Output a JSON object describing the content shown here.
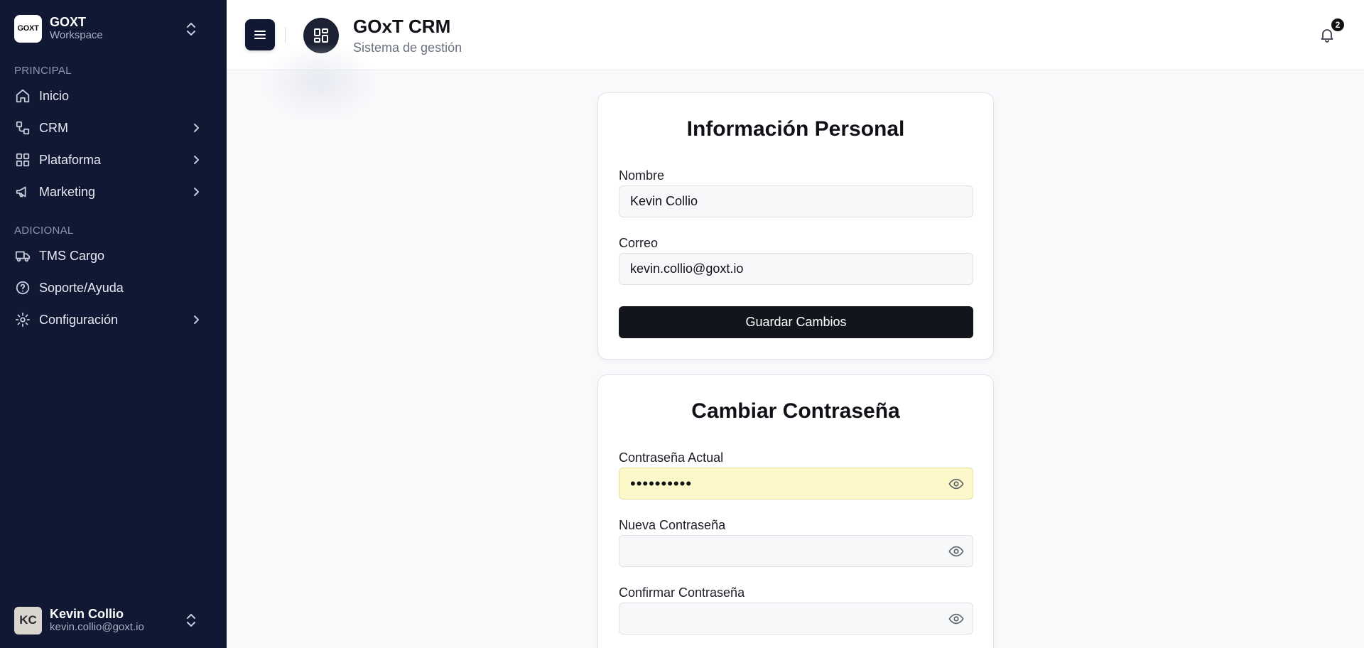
{
  "workspace": {
    "logo_text": "GOXT",
    "name": "GOXT",
    "subtitle": "Workspace",
    "toggle_icon": "chevrons-up-down-icon"
  },
  "sidebar": {
    "sections": [
      {
        "label": "PRINCIPAL"
      },
      {
        "label": "ADICIONAL"
      }
    ],
    "items": [
      {
        "label": "Inicio",
        "icon": "home-icon",
        "has_chevron": false
      },
      {
        "label": "CRM",
        "icon": "workflow-icon",
        "has_chevron": true
      },
      {
        "label": "Plataforma",
        "icon": "grid-icon",
        "has_chevron": true
      },
      {
        "label": "Marketing",
        "icon": "megaphone-icon",
        "has_chevron": true
      },
      {
        "label": "TMS Cargo",
        "icon": "truck-icon",
        "has_chevron": false
      },
      {
        "label": "Soporte/Ayuda",
        "icon": "help-circle-icon",
        "has_chevron": false
      },
      {
        "label": "Configuración",
        "icon": "gear-icon",
        "has_chevron": true
      }
    ]
  },
  "user": {
    "initials": "KC",
    "name": "Kevin Collio",
    "email": "kevin.collio@goxt.io"
  },
  "header": {
    "title": "GOxT CRM",
    "subtitle": "Sistema de gestión",
    "notifications_count": "2"
  },
  "personal_info": {
    "title": "Información Personal",
    "name_label": "Nombre",
    "name_value": "Kevin Collio",
    "email_label": "Correo",
    "email_value": "kevin.collio@goxt.io",
    "save_label": "Guardar Cambios"
  },
  "password": {
    "title": "Cambiar Contraseña",
    "current_label": "Contraseña Actual",
    "current_value": "••••••••••",
    "new_label": "Nueva Contraseña",
    "new_value": "",
    "confirm_label": "Confirmar Contraseña",
    "confirm_value": ""
  },
  "colors": {
    "sidebar_bg": "#111834",
    "primary_button": "#13151c",
    "autofill_bg": "#fdf8c9"
  }
}
